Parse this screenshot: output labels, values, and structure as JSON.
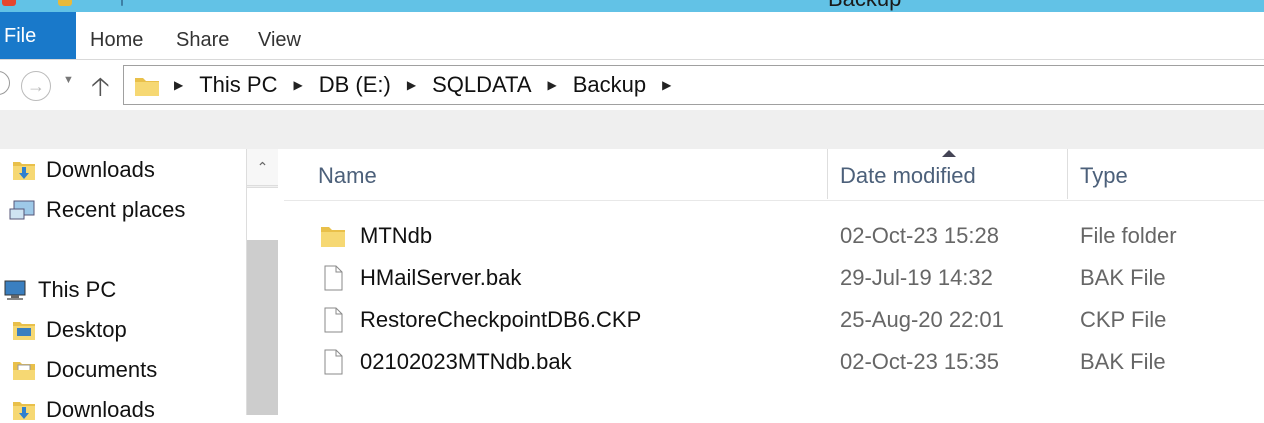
{
  "window": {
    "title": "Backup"
  },
  "ribbon": {
    "tabs": [
      "File",
      "Home",
      "Share",
      "View"
    ]
  },
  "address": {
    "crumbs": [
      "This PC",
      "DB (E:)",
      "SQLDATA",
      "Backup"
    ]
  },
  "nav": {
    "items": [
      {
        "label": "Downloads",
        "icon": "downloads-folder-icon"
      },
      {
        "label": "Recent places",
        "icon": "recent-places-icon"
      },
      {
        "label": "This PC",
        "icon": "computer-icon"
      },
      {
        "label": "Desktop",
        "icon": "folder-icon"
      },
      {
        "label": "Documents",
        "icon": "documents-folder-icon"
      },
      {
        "label": "Downloads",
        "icon": "downloads-folder-icon"
      }
    ]
  },
  "columns": {
    "name": "Name",
    "date": "Date modified",
    "type": "Type"
  },
  "files": [
    {
      "name": "MTNdb",
      "date": "02-Oct-23 15:28",
      "type": "File folder",
      "icon": "folder-icon"
    },
    {
      "name": "HMailServer.bak",
      "date": "29-Jul-19 14:32",
      "type": "BAK File",
      "icon": "file-icon"
    },
    {
      "name": "RestoreCheckpointDB6.CKP",
      "date": "25-Aug-20 22:01",
      "type": "CKP File",
      "icon": "file-icon"
    },
    {
      "name": "02102023MTNdb.bak",
      "date": "02-Oct-23 15:35",
      "type": "BAK File",
      "icon": "file-icon"
    }
  ]
}
